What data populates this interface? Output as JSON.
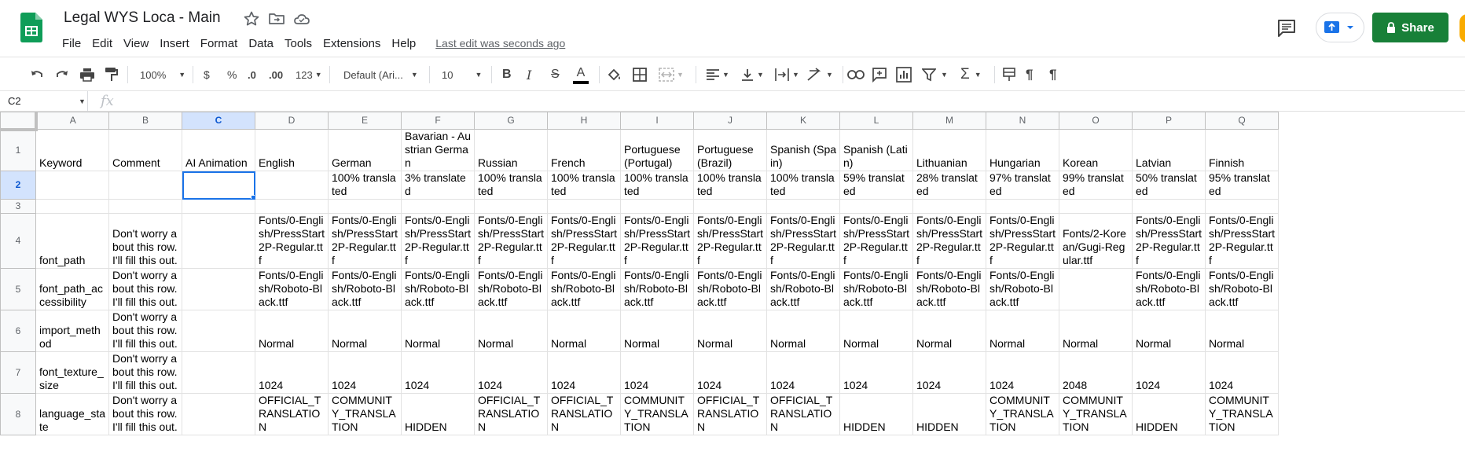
{
  "app": {
    "title": "Legal WYS Loca - Main",
    "menu": [
      "File",
      "Edit",
      "View",
      "Insert",
      "Format",
      "Data",
      "Tools",
      "Extensions",
      "Help"
    ],
    "last_edit": "Last edit was seconds ago",
    "share_label": "Share",
    "accent_green": "#188038",
    "selection_blue": "#1a73e8"
  },
  "toolbar": {
    "zoom": "100%",
    "currency": "$",
    "percent": "%",
    "decimal_decrease": ".0",
    "decimal_increase": ".00",
    "number_format": "123",
    "font": "Default (Ari...",
    "font_size": "10",
    "bold": "B",
    "italic": "I",
    "strike": "S",
    "text_color": "A",
    "sum": "Σ"
  },
  "formula": {
    "namebox": "C2",
    "fx": "fx",
    "value": ""
  },
  "grid": {
    "active_cell": {
      "col": 2,
      "row": 2
    },
    "columns": [
      "A",
      "B",
      "C",
      "D",
      "E",
      "F",
      "G",
      "H",
      "I",
      "J",
      "K",
      "L",
      "M",
      "N",
      "O",
      "P",
      "Q"
    ],
    "rows": [
      {
        "num": "1",
        "cells": [
          "Keyword",
          "Comment",
          "AI Animation",
          "English",
          "German",
          "Bavarian - Austrian German",
          "Russian",
          "French",
          "Portuguese (Portugal)",
          "Portuguese (Brazil)",
          "Spanish (Spain)",
          "Spanish (Latin)",
          "Lithuanian",
          "Hungarian",
          "Korean",
          "Latvian",
          "Finnish"
        ]
      },
      {
        "num": "2",
        "cells": [
          "",
          "",
          "",
          "",
          "100% translated",
          "3% translated",
          "100% translated",
          "100% translated",
          "100% translated",
          "100% translated",
          "100% translated",
          "59% translated",
          "28% translated",
          "97% translated",
          "99% translated",
          "50% translated",
          "95% translated"
        ]
      },
      {
        "num": "3",
        "cells": [
          "",
          "",
          "",
          "",
          "",
          "",
          "",
          "",
          "",
          "",
          "",
          "",
          "",
          "",
          "",
          "",
          ""
        ]
      },
      {
        "num": "4",
        "cells": [
          "font_path",
          "Don't worry about this row. I'll fill this out.",
          "",
          "Fonts/0-English/PressStart2P-Regular.ttf",
          "Fonts/0-English/PressStart2P-Regular.ttf",
          "Fonts/0-English/PressStart2P-Regular.ttf",
          "Fonts/0-English/PressStart2P-Regular.ttf",
          "Fonts/0-English/PressStart2P-Regular.ttf",
          "Fonts/0-English/PressStart2P-Regular.ttf",
          "Fonts/0-English/PressStart2P-Regular.ttf",
          "Fonts/0-English/PressStart2P-Regular.ttf",
          "Fonts/0-English/PressStart2P-Regular.ttf",
          "Fonts/0-English/PressStart2P-Regular.ttf",
          "Fonts/0-English/PressStart2P-Regular.ttf",
          "Fonts/2-Korean/Gugi-Regular.ttf",
          "Fonts/0-English/PressStart2P-Regular.ttf",
          "Fonts/0-English/PressStart2P-Regular.ttf"
        ]
      },
      {
        "num": "5",
        "cells": [
          "font_path_accessibility",
          "Don't worry about this row. I'll fill this out.",
          "",
          "Fonts/0-English/Roboto-Black.ttf",
          "Fonts/0-English/Roboto-Black.ttf",
          "Fonts/0-English/Roboto-Black.ttf",
          "Fonts/0-English/Roboto-Black.ttf",
          "Fonts/0-English/Roboto-Black.ttf",
          "Fonts/0-English/Roboto-Black.ttf",
          "Fonts/0-English/Roboto-Black.ttf",
          "Fonts/0-English/Roboto-Black.ttf",
          "Fonts/0-English/Roboto-Black.ttf",
          "Fonts/0-English/Roboto-Black.ttf",
          "Fonts/0-English/Roboto-Black.ttf",
          "",
          "Fonts/0-English/Roboto-Black.ttf",
          "Fonts/0-English/Roboto-Black.ttf"
        ]
      },
      {
        "num": "6",
        "cells": [
          "import_method",
          "Don't worry about this row. I'll fill this out.",
          "",
          "Normal",
          "Normal",
          "Normal",
          "Normal",
          "Normal",
          "Normal",
          "Normal",
          "Normal",
          "Normal",
          "Normal",
          "Normal",
          "Normal",
          "Normal",
          "Normal"
        ]
      },
      {
        "num": "7",
        "cells": [
          "font_texture_size",
          "Don't worry about this row. I'll fill this out.",
          "",
          "1024",
          "1024",
          "1024",
          "1024",
          "1024",
          "1024",
          "1024",
          "1024",
          "1024",
          "1024",
          "1024",
          "2048",
          "1024",
          "1024"
        ]
      },
      {
        "num": "8",
        "cells": [
          "language_state",
          "Don't worry about this row. I'll fill this out.",
          "",
          "OFFICIAL_TRANSLATION",
          "COMMUNITY_TRANSLATION",
          "HIDDEN",
          "OFFICIAL_TRANSLATION",
          "OFFICIAL_TRANSLATION",
          "COMMUNITY_TRANSLATION",
          "OFFICIAL_TRANSLATION",
          "OFFICIAL_TRANSLATION",
          "HIDDEN",
          "HIDDEN",
          "COMMUNITY_TRANSLATION",
          "COMMUNITY_TRANSLATION",
          "HIDDEN",
          "COMMUNITY_TRANSLATION"
        ]
      }
    ]
  }
}
